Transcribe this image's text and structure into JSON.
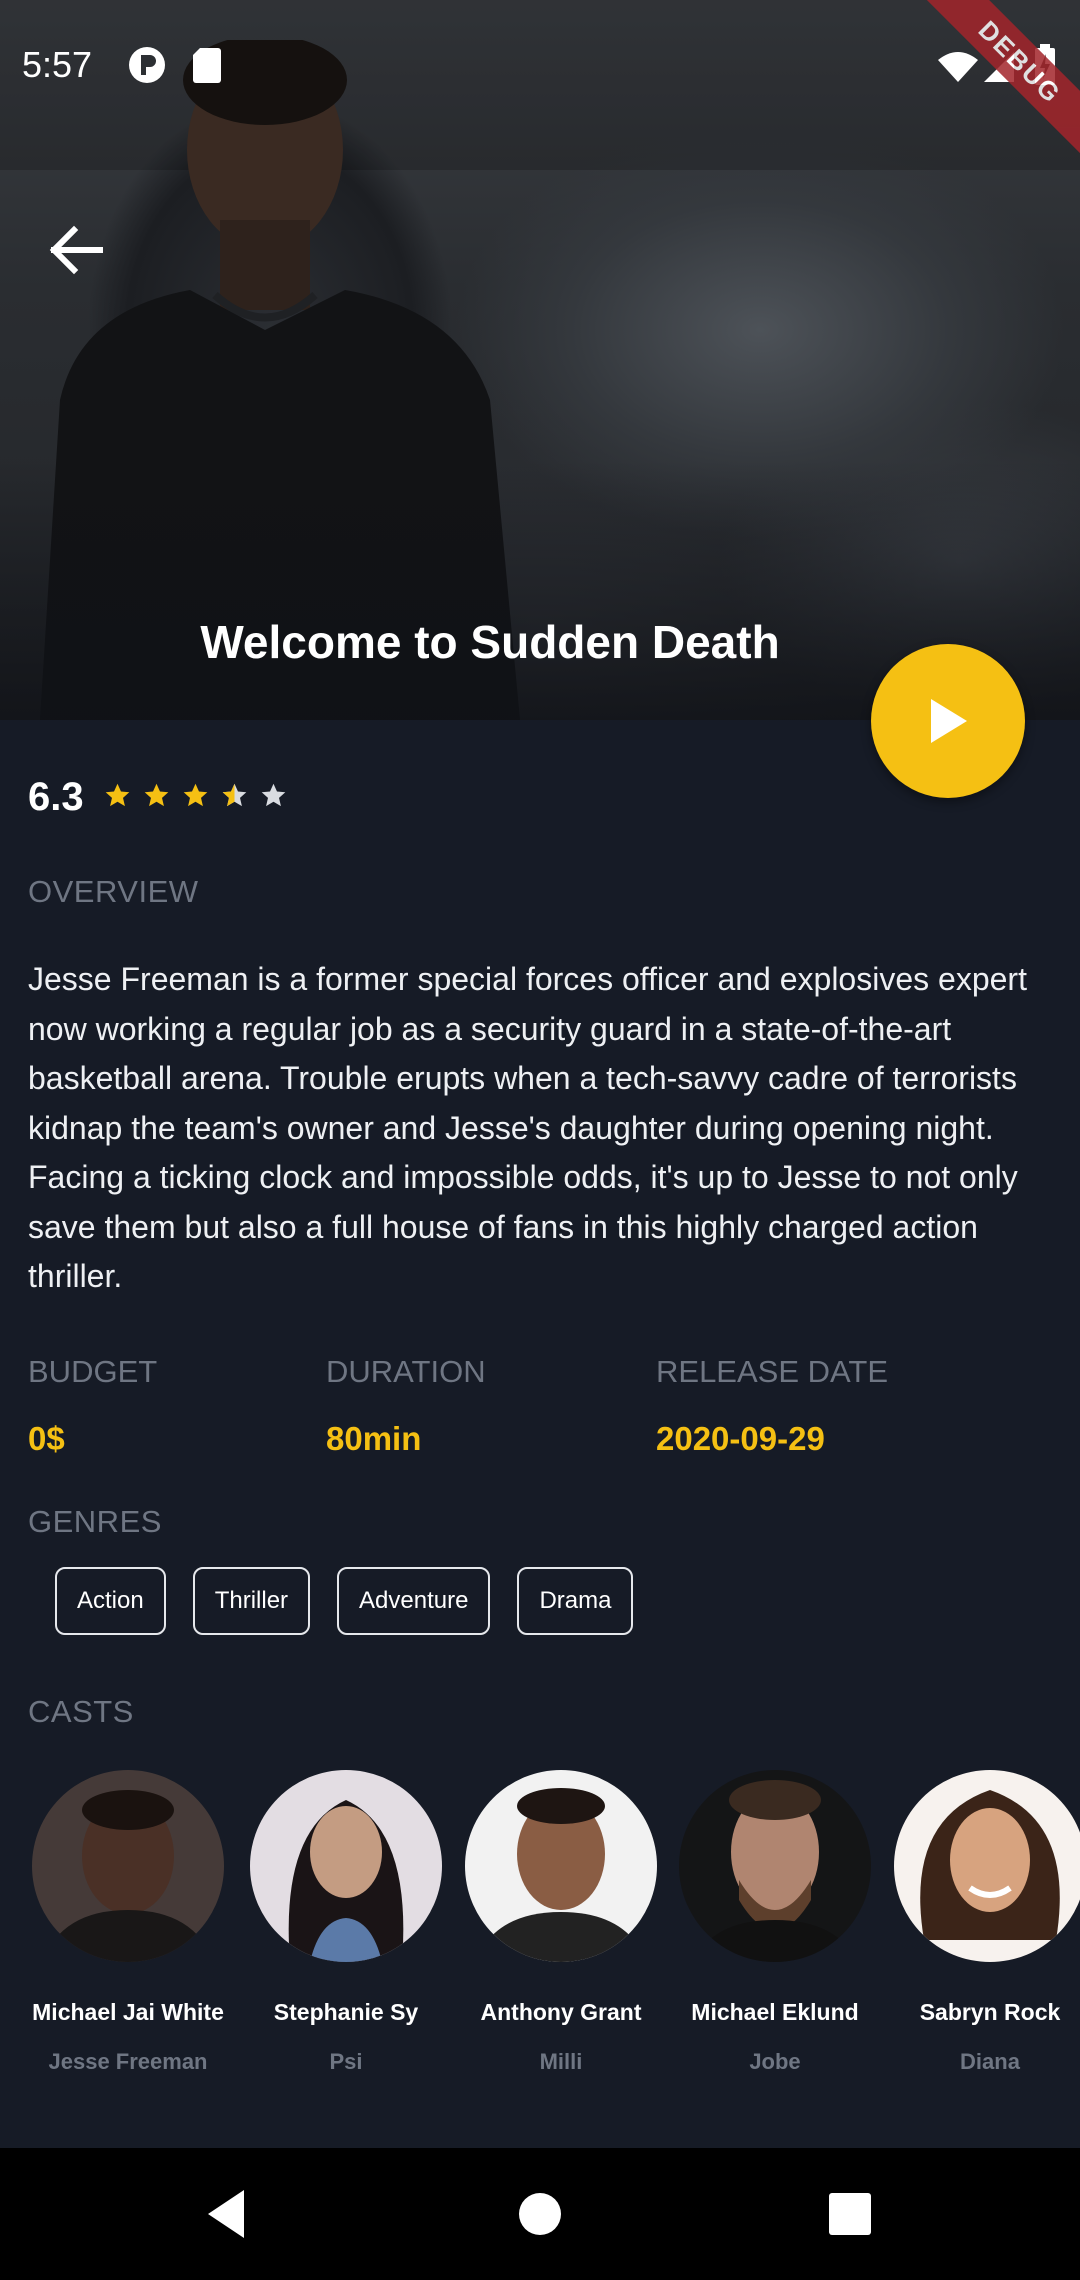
{
  "status_bar": {
    "time": "5:57",
    "debug_label": "DEBUG"
  },
  "movie": {
    "title": "Welcome to Sudden Death",
    "rating": "6.3",
    "rating_stars": 3.5,
    "overview_label": "OVERVIEW",
    "overview": "Jesse Freeman is a former special forces officer and explosives expert now working a regular job as a security guard in a state-of-the-art basketball arena. Trouble erupts when a tech-savvy cadre of terrorists kidnap the team's owner and Jesse's daughter during opening night. Facing a ticking clock and impossible odds, it's up to Jesse to not only save them but also a full house of fans in this highly charged action thriller."
  },
  "stats": {
    "budget_label": "BUDGET",
    "budget": "0$",
    "duration_label": "DURATION",
    "duration": "80min",
    "release_label": "RELEASE DATE",
    "release": "2020-09-29"
  },
  "genres_label": "GENRES",
  "genres": [
    "Action",
    "Thriller",
    "Adventure",
    "Drama"
  ],
  "casts_label": "CASTS",
  "casts": [
    {
      "name": "Michael Jai White",
      "role": "Jesse Freeman"
    },
    {
      "name": "Stephanie Sy",
      "role": "Psi"
    },
    {
      "name": "Anthony Grant",
      "role": "Milli"
    },
    {
      "name": "Michael Eklund",
      "role": "Jobe"
    },
    {
      "name": "Sabryn Rock",
      "role": "Diana"
    }
  ],
  "icons": {
    "back": "arrow-left-icon",
    "play": "play-icon",
    "nav": [
      "nav-back-icon",
      "nav-home-icon",
      "nav-recents-icon"
    ]
  },
  "colors": {
    "accent": "#f5c013",
    "background": "#161b26",
    "muted": "#6f7683"
  }
}
